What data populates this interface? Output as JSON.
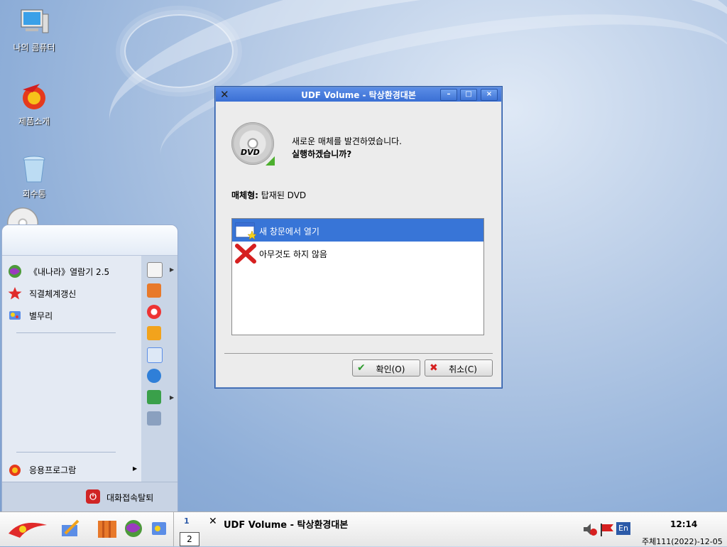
{
  "desktop": {
    "icons": [
      {
        "label": "나의 콤퓨터",
        "icon": "computer-icon"
      },
      {
        "label": "제품소개",
        "icon": "product-intro-icon"
      },
      {
        "label": "회수통",
        "icon": "trash-icon"
      }
    ]
  },
  "dialog": {
    "title": "UDF Volume - 탁상환경대본",
    "message_line1": "새로운 매체를 발견하였습니다.",
    "message_line2": "실행하겠습니까?",
    "media_label": "매체형:",
    "media_value": "탑재된 DVD",
    "disc_label": "DVD",
    "options": [
      {
        "label": "새 창문에서 열기",
        "icon": "open-window-icon",
        "selected": true
      },
      {
        "label": "아무것도 하지 않음",
        "icon": "red-x-icon",
        "selected": false
      }
    ],
    "ok_label": "확인(O)",
    "cancel_label": "취소(C)"
  },
  "start_menu": {
    "items": [
      {
        "label": "《내나라》열람기 2.5",
        "icon": "browser-globe-icon"
      },
      {
        "label": "직결체계갱신",
        "icon": "update-star-icon"
      },
      {
        "label": "별무리",
        "icon": "star-cluster-icon"
      }
    ],
    "apps_label": "응용프로그람",
    "logout_label": "대화접속탈퇴"
  },
  "taskbar": {
    "workspace_1": "1",
    "workspace_2": "2",
    "active_task": "UDF Volume - 탁상환경대본",
    "time": "12:14",
    "date": "주체111(2022)-12-05",
    "lang": "En"
  },
  "colors": {
    "titlebar": "#3a6fd4",
    "selection": "#3875d7"
  }
}
